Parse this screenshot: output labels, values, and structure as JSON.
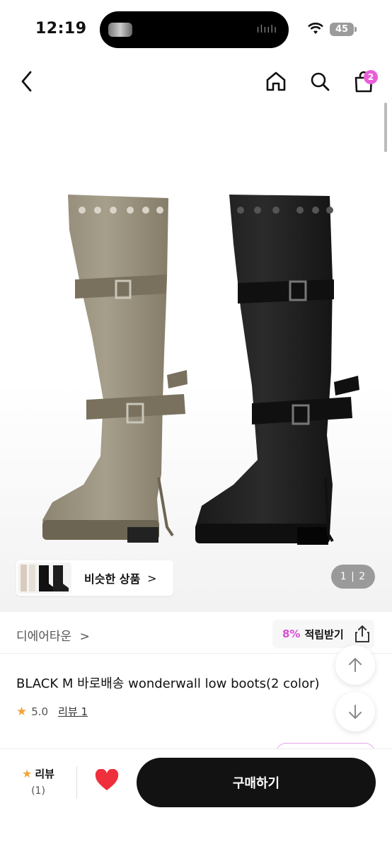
{
  "status": {
    "time": "12:19",
    "battery": "45"
  },
  "nav": {
    "cart_count": "2"
  },
  "hero": {
    "similar_label": "비슷한 상품",
    "similar_chevron": ">",
    "pager": "1 | 2"
  },
  "shop": {
    "name": "디에어타운",
    "name_chevron": ">",
    "points_pct": "8%",
    "points_label": "적립받기"
  },
  "product": {
    "title": "BLACK M 바로배송 wonderwall low boots(2 color)",
    "rating": "5.0",
    "reviews_label": "리뷰 1"
  },
  "bottom": {
    "review_label": "리뷰",
    "review_count": "(1)",
    "buy_label": "구매하기"
  },
  "colors": {
    "accent": "#e95ed8",
    "star": "#f2a33a",
    "buy_button": "#121212"
  }
}
